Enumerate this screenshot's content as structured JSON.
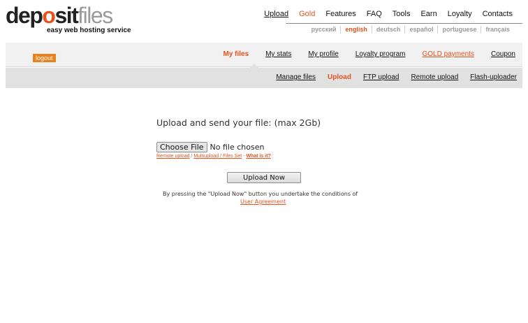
{
  "logo": {
    "part_dep": "dep",
    "part_o": "o",
    "part_sit": "sit",
    "part_files": "files",
    "tagline": "easy web hosting service"
  },
  "top_nav": {
    "upload": "Upload",
    "gold": "Gold",
    "features": "Features",
    "faq": "FAQ",
    "tools": "Tools",
    "earn": "Earn",
    "loyalty": "Loyalty",
    "contacts": "Contacts"
  },
  "languages": [
    "русский",
    "english",
    "deutsch",
    "español",
    "portuguese",
    "français"
  ],
  "menu1": {
    "logout": "logout",
    "my_files": "My files",
    "my_stats": "My stats",
    "my_profile": "My profile",
    "loyalty_program": "Loyalty program",
    "gold_payments": "GOLD payments",
    "coupon": "Coupon"
  },
  "menu2": {
    "manage_files": "Manage files",
    "upload": "Upload",
    "ftp_upload": "FTP upload",
    "remote_upload": "Remote upload",
    "flash_uploader": "Flash-uploader"
  },
  "upload": {
    "heading": "Upload and send your file: (max 2Gb)",
    "choose_file": "Choose File",
    "no_file": "No file chosen",
    "remote_upload_link": "Remote upload",
    "slash": " / ",
    "multiupload_link": "Multiupload / Files Set",
    "dash": " - ",
    "what_is_it_link": "What is it?",
    "upload_now": "Upload Now",
    "agreement_text": "By pressing the \"Upload Now\" button you undertake the conditions of",
    "agreement_link": "User Agreement"
  },
  "colors": {
    "accent": "#e7521d",
    "logout_bg": "#e7821d",
    "menu1_bg": "#f1f1f1",
    "menu2_bg": "#e1e1e1"
  }
}
